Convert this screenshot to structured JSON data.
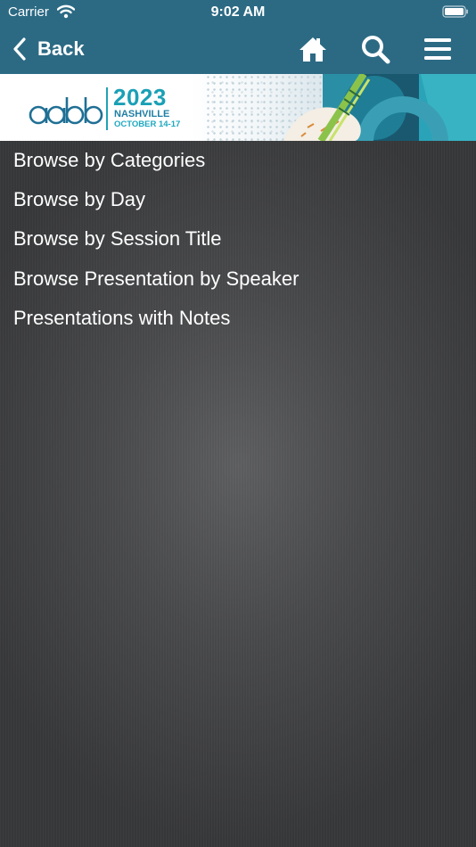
{
  "status_bar": {
    "carrier": "Carrier",
    "time": "9:02 AM",
    "icons": [
      "wifi-icon",
      "battery-icon"
    ]
  },
  "nav": {
    "back_label": "Back",
    "icons": [
      "chevron-left-icon",
      "home-icon",
      "search-icon",
      "hamburger-menu-icon"
    ],
    "color": "#2c6a84"
  },
  "banner": {
    "logo_year": "2023",
    "logo_city": "NASHVILLE",
    "logo_dates": "OCTOBER 14-17",
    "logo_wordmark": "aabb",
    "accent_color": "#1aa0b6"
  },
  "menu": {
    "items": [
      {
        "label": "Browse by Categories"
      },
      {
        "label": "Browse by Day"
      },
      {
        "label": "Browse by Session Title"
      },
      {
        "label": "Browse Presentation by Speaker"
      },
      {
        "label": "Presentations with Notes"
      }
    ]
  }
}
